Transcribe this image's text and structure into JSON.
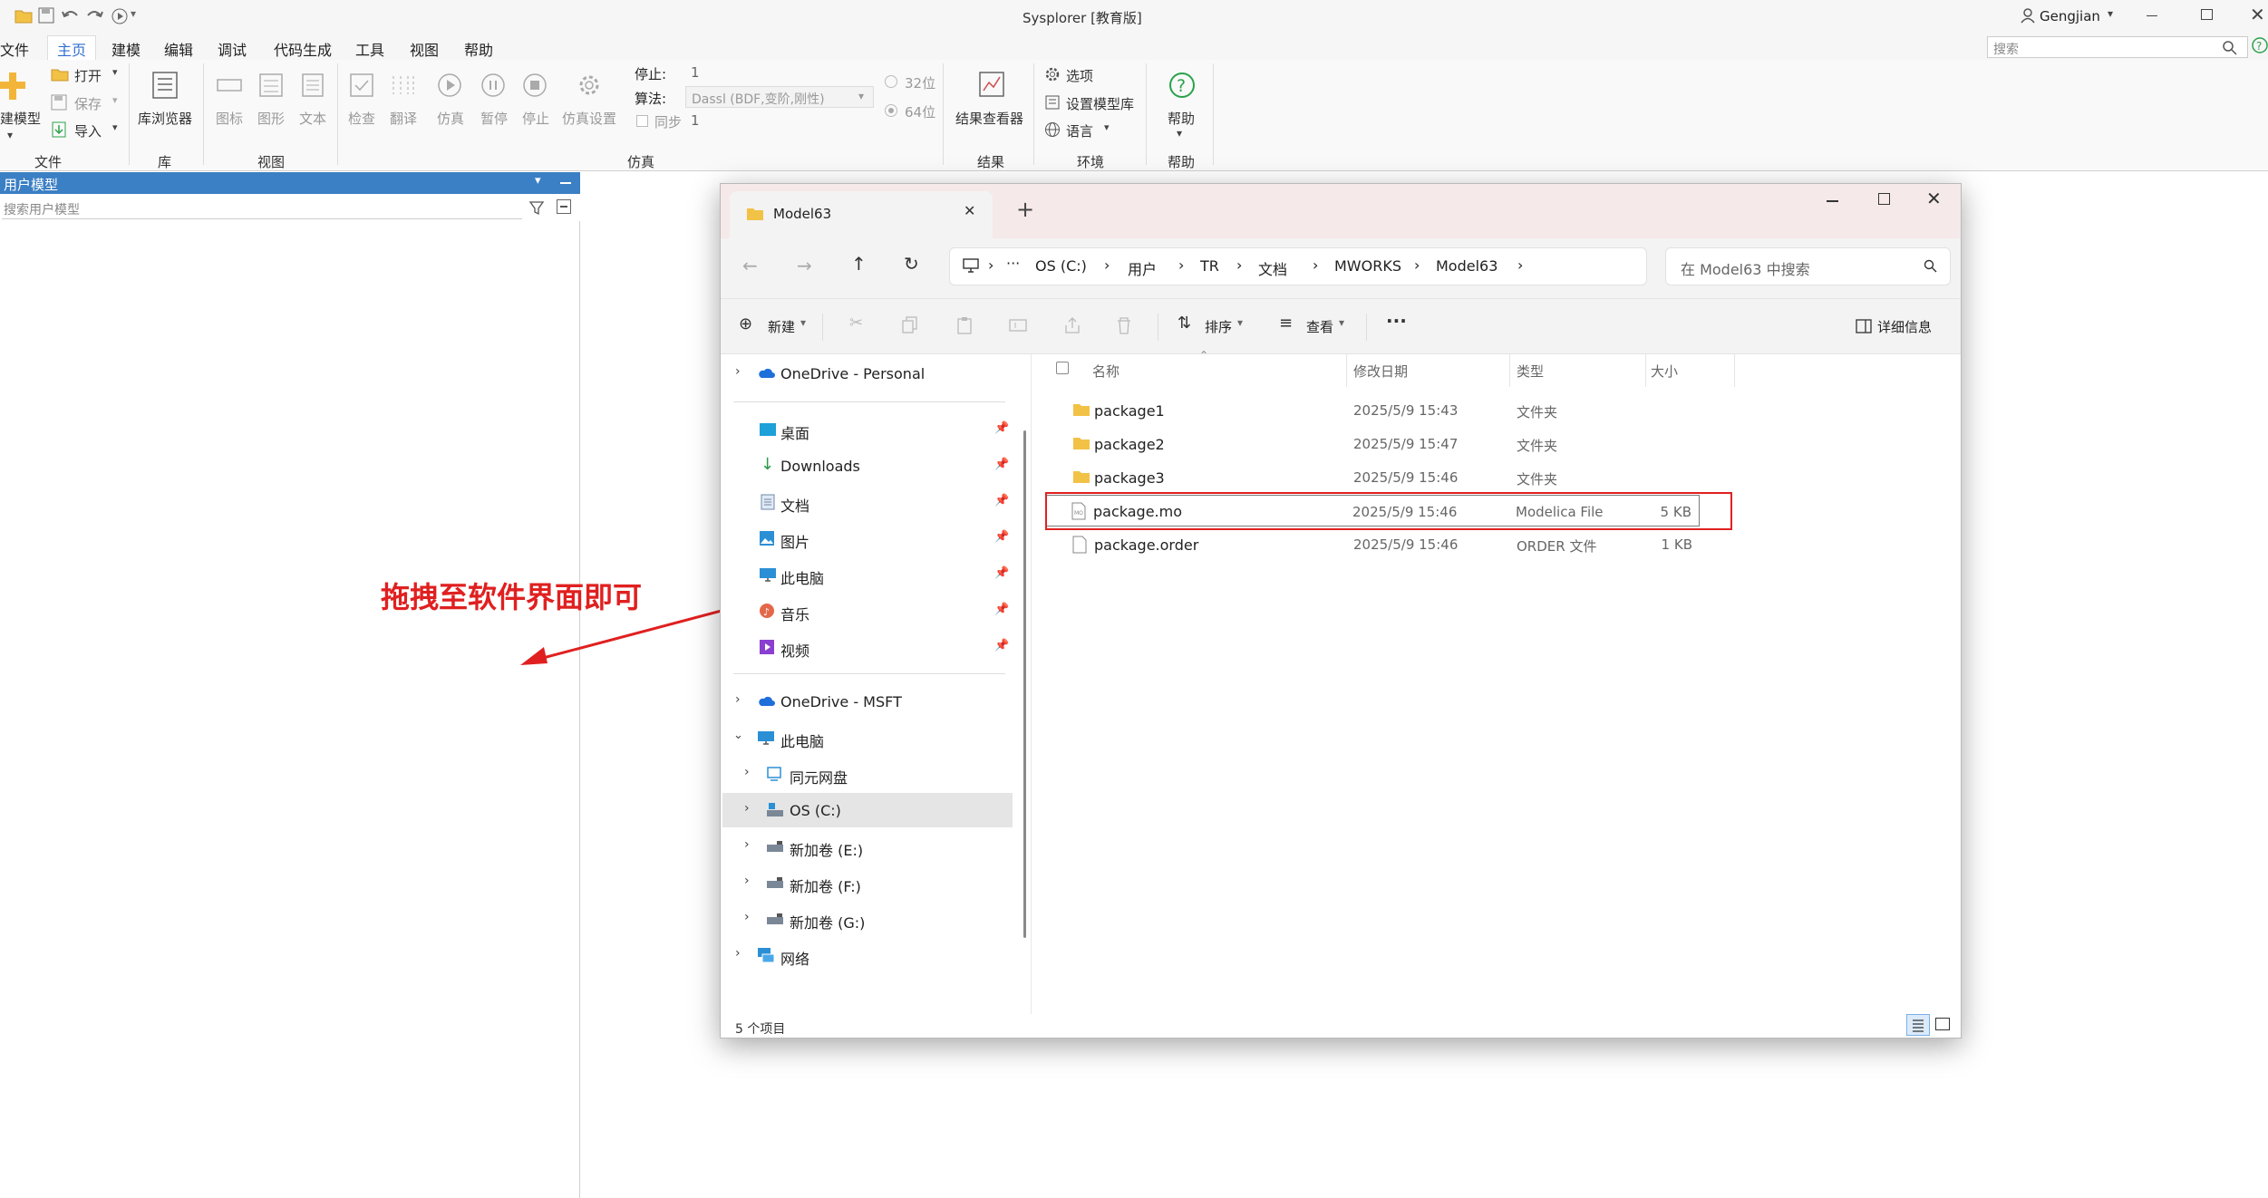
{
  "app": {
    "title": "Sysplorer [教育版]",
    "user": "Gengjian",
    "search_placeholder": "搜索"
  },
  "menu": [
    "文件",
    "主页",
    "建模",
    "编辑",
    "调试",
    "代码生成",
    "工具",
    "视图",
    "帮助"
  ],
  "ribbon": {
    "file_group": {
      "new_model": "建模型",
      "open": "打开",
      "save": "保存",
      "import": "导入",
      "title": "文件"
    },
    "lib_group": {
      "browser": "库浏览器",
      "title": "库"
    },
    "view_group": {
      "icon": "图标",
      "diagram": "图形",
      "text": "文本",
      "title": "视图"
    },
    "sim_group": {
      "check": "检查",
      "translate": "翻译",
      "simulate": "仿真",
      "pause": "暂停",
      "stop": "停止",
      "settings": "仿真设置",
      "title": "仿真",
      "stop_label": "停止:",
      "stop_value": "1",
      "algo_label": "算法:",
      "algo_value": "Dassl (BDF,变阶,刚性)",
      "sync_label": "同步",
      "sync_value": "1",
      "bit32": "32位",
      "bit64": "64位"
    },
    "result_group": {
      "viewer": "结果查看器",
      "title": "结果"
    },
    "env_group": {
      "options": "选项",
      "model_lib": "设置模型库",
      "language": "语言",
      "title": "环境"
    },
    "help_group": {
      "help": "帮助",
      "title": "帮助"
    }
  },
  "left_panel": {
    "title": "用户模型",
    "search_placeholder": "搜索用户模型"
  },
  "annotation": {
    "text": "拖拽至软件界面即可",
    "color": "#e02020"
  },
  "explorer": {
    "tab_title": "Model63",
    "breadcrumb": [
      "OS (C:)",
      "用户",
      "TR",
      "文档",
      "MWORKS",
      "Model63"
    ],
    "search_placeholder": "在 Model63 中搜索",
    "toolbar": {
      "new": "新建",
      "sort": "排序",
      "view": "查看",
      "details": "详细信息"
    },
    "nav": {
      "onedrive_personal": "OneDrive - Personal",
      "quick": [
        "桌面",
        "Downloads",
        "文档",
        "图片",
        "此电脑",
        "音乐",
        "视频"
      ],
      "onedrive_msft": "OneDrive - MSFT",
      "this_pc": "此电脑",
      "drives": [
        "同元网盘",
        "OS (C:)",
        "新加卷 (E:)",
        "新加卷 (F:)",
        "新加卷 (G:)"
      ],
      "network": "网络"
    },
    "columns": {
      "name": "名称",
      "date": "修改日期",
      "type": "类型",
      "size": "大小"
    },
    "files": [
      {
        "name": "package1",
        "date": "2025/5/9 15:43",
        "type": "文件夹",
        "size": ""
      },
      {
        "name": "package2",
        "date": "2025/5/9 15:47",
        "type": "文件夹",
        "size": ""
      },
      {
        "name": "package3",
        "date": "2025/5/9 15:46",
        "type": "文件夹",
        "size": ""
      },
      {
        "name": "package.mo",
        "date": "2025/5/9 15:46",
        "type": "Modelica File",
        "size": "5 KB"
      },
      {
        "name": "package.order",
        "date": "2025/5/9 15:46",
        "type": "ORDER 文件",
        "size": "1 KB"
      }
    ],
    "status": "5 个项目"
  }
}
